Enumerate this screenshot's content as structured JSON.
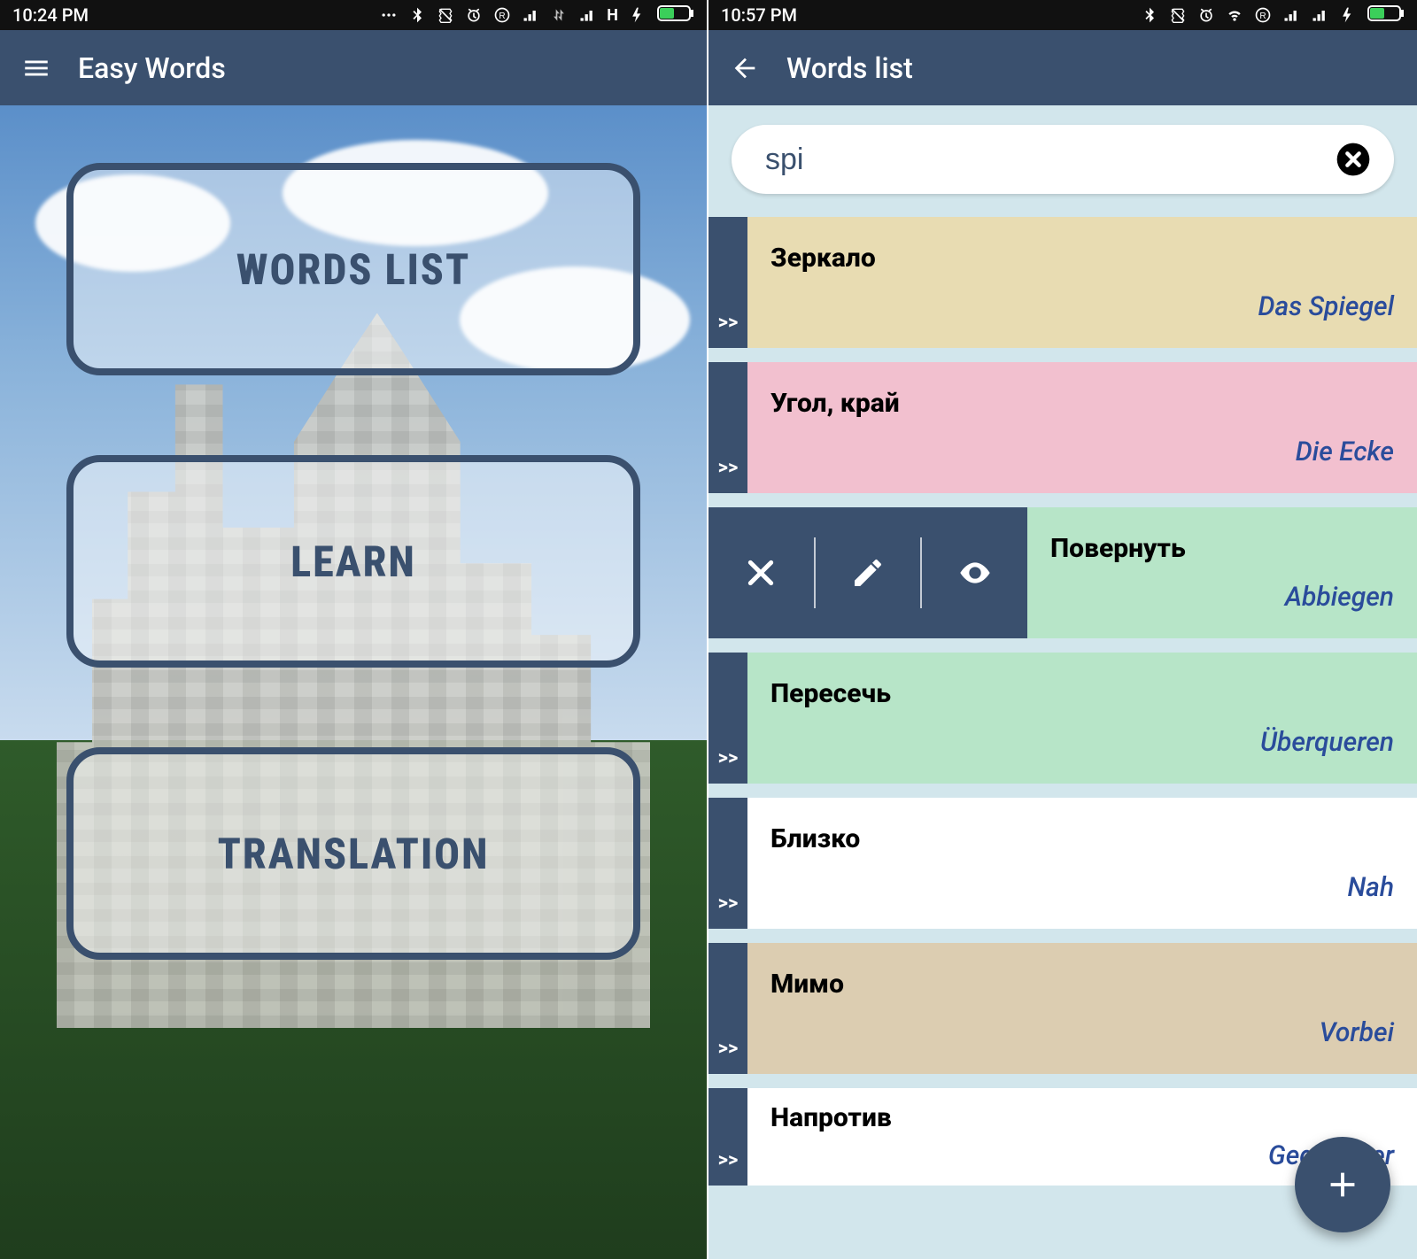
{
  "left": {
    "status_time": "10:24 PM",
    "appbar_title": "Easy Words",
    "buttons": {
      "words_list": "WORDS LIST",
      "learn": "LEARN",
      "translation": "TRANSLATION"
    }
  },
  "right": {
    "status_time": "10:57 PM",
    "appbar_title": "Words list",
    "search_value": "spi",
    "handle_label": ">>",
    "rows": [
      {
        "ru": "Зеркало",
        "de": "Das Spiegel",
        "bg": "bg-tan"
      },
      {
        "ru": "Угол, край",
        "de": "Die Ecke",
        "bg": "bg-pink"
      },
      {
        "ru": "Повернуть",
        "de": "Abbiegen",
        "bg": "bg-mint",
        "swiped": true,
        "hidden_marker": true
      },
      {
        "ru": "Пересечь",
        "de": "Überqueren",
        "bg": "bg-mint"
      },
      {
        "ru": "Близко",
        "de": "Nah",
        "bg": "bg-white"
      },
      {
        "ru": "Мимо",
        "de": "Vorbei",
        "bg": "bg-sand"
      },
      {
        "ru": "Напротив",
        "de": "Gegenüber",
        "bg": "bg-white",
        "partial": true
      }
    ]
  },
  "colors": {
    "primary": "#3a506e",
    "accent_text": "#2a4c9b",
    "search_bg": "#d2e6ec"
  }
}
